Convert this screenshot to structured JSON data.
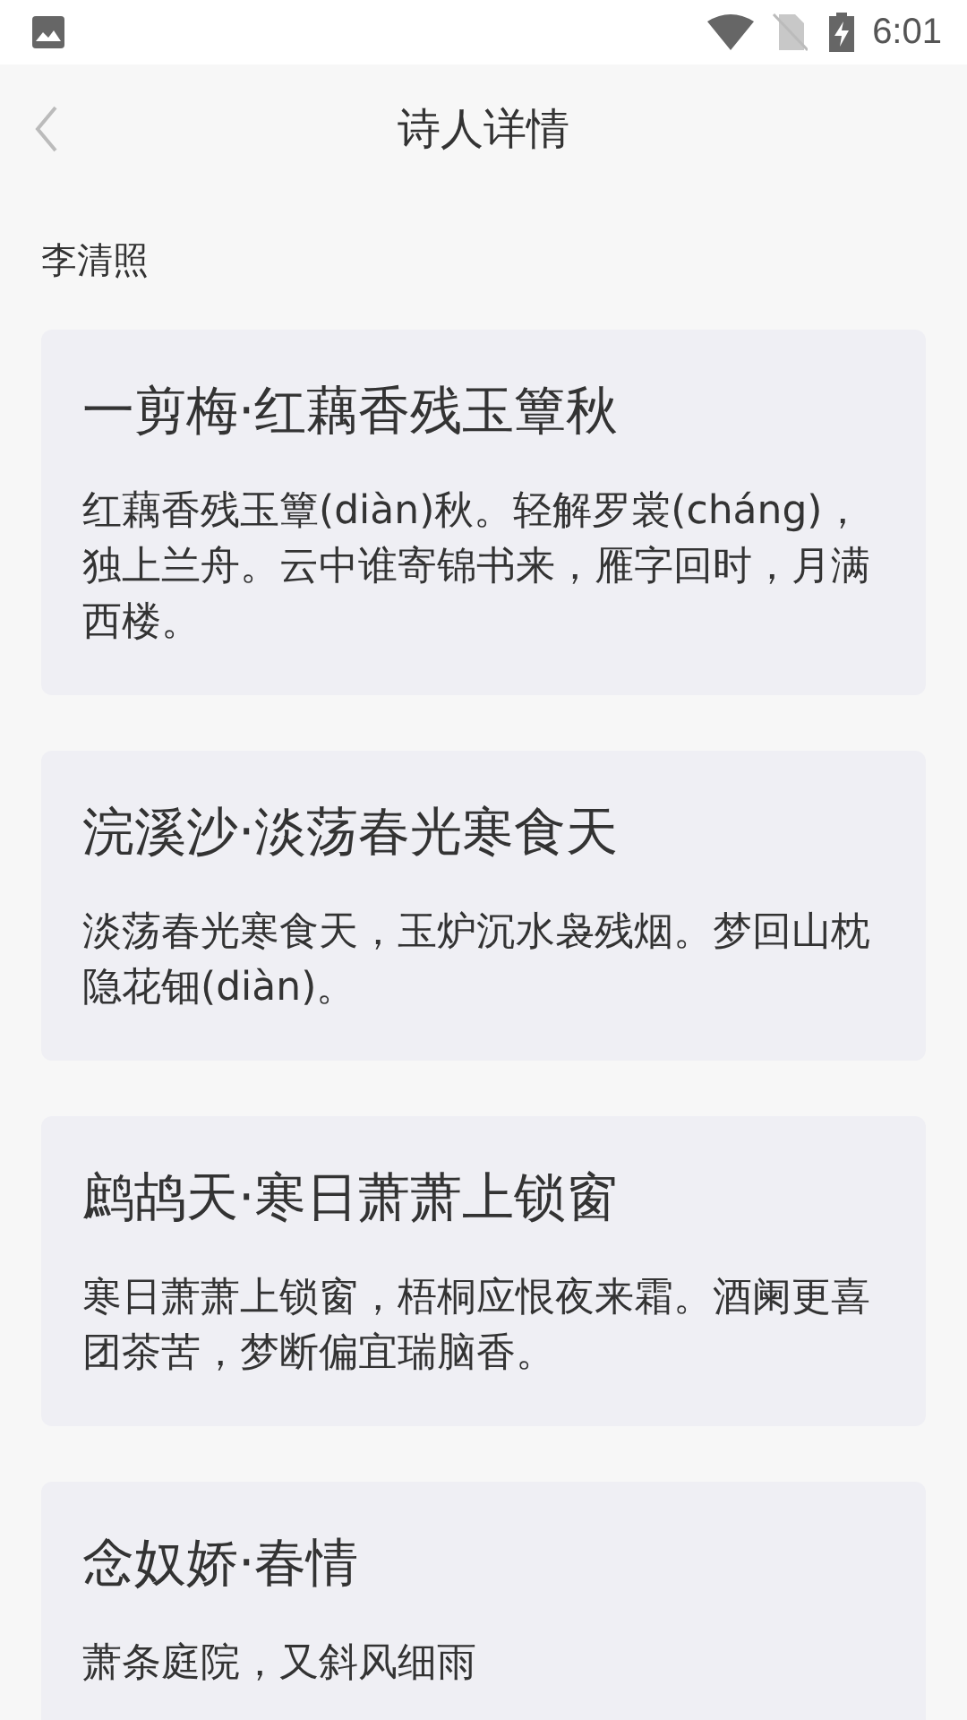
{
  "status_bar": {
    "time": "6:01"
  },
  "header": {
    "title": "诗人详情"
  },
  "poet": {
    "name": "李清照"
  },
  "poems": [
    {
      "title": "一剪梅·红藕香残玉簟秋",
      "excerpt": "红藕香残玉簟(diàn)秋。轻解罗裳(cháng)，独上兰舟。云中谁寄锦书来，雁字回时，月满西楼。"
    },
    {
      "title": "浣溪沙·淡荡春光寒食天",
      "excerpt": "淡荡春光寒食天，玉炉沉水袅残烟。梦回山枕隐花钿(diàn)。"
    },
    {
      "title": "鹧鸪天·寒日萧萧上锁窗",
      "excerpt": "寒日萧萧上锁窗，梧桐应恨夜来霜。酒阑更喜团茶苦，梦断偏宜瑞脑香。"
    },
    {
      "title": "念奴娇·春情",
      "excerpt": "萧条庭院，又斜风细雨"
    }
  ]
}
